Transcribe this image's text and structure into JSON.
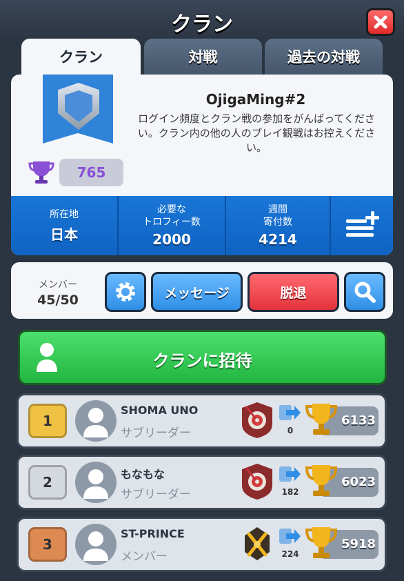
{
  "header": {
    "title": "クラン"
  },
  "tabs": [
    {
      "label": "クラン",
      "active": true
    },
    {
      "label": "対戦",
      "active": false
    },
    {
      "label": "過去の対戦",
      "active": false
    }
  ],
  "clan": {
    "name": "OjigaMing#2",
    "description": "ログイン頻度とクラン戦の参加をがんばってください。クラン内の他の人のプレイ観戦はお控えください。",
    "trophies": "765",
    "stats": [
      {
        "label": "所在地",
        "value": "日本"
      },
      {
        "label": "必要な\nトロフィー数",
        "value": "2000"
      },
      {
        "label": "週間\n寄付数",
        "value": "4214"
      }
    ]
  },
  "toolbar": {
    "members_label": "メンバー",
    "members_count": "45/50",
    "message_label": "メッセージ",
    "leave_label": "脱退"
  },
  "invite": {
    "label": "クランに招待"
  },
  "members": [
    {
      "rank": "1",
      "name": "SHOMA UNO",
      "role": "サブリーダー",
      "donations": "0",
      "trophies": "6133"
    },
    {
      "rank": "2",
      "name": "もなもな",
      "role": "サブリーダー",
      "donations": "182",
      "trophies": "6023"
    },
    {
      "rank": "3",
      "name": "ST-PRINCE",
      "role": "メンバー",
      "donations": "224",
      "trophies": "5918"
    }
  ],
  "colors": {
    "accent_blue": "#1976d7",
    "invite_green": "#22b53f",
    "leave_red": "#e3333b",
    "trophy_purple": "#8b4fd6"
  }
}
